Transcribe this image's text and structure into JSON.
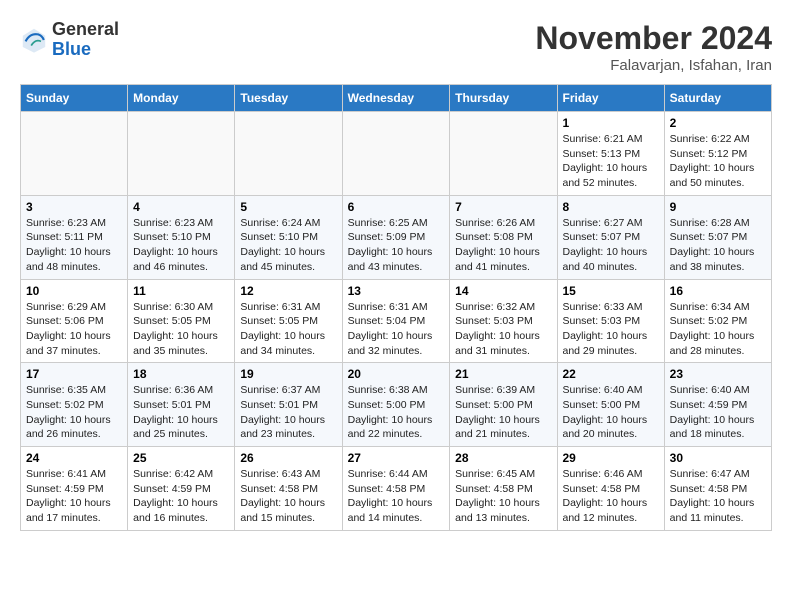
{
  "header": {
    "logo_line1": "General",
    "logo_line2": "Blue",
    "month": "November 2024",
    "location": "Falavarjan, Isfahan, Iran"
  },
  "weekdays": [
    "Sunday",
    "Monday",
    "Tuesday",
    "Wednesday",
    "Thursday",
    "Friday",
    "Saturday"
  ],
  "weeks": [
    [
      {
        "day": "",
        "info": ""
      },
      {
        "day": "",
        "info": ""
      },
      {
        "day": "",
        "info": ""
      },
      {
        "day": "",
        "info": ""
      },
      {
        "day": "",
        "info": ""
      },
      {
        "day": "1",
        "info": "Sunrise: 6:21 AM\nSunset: 5:13 PM\nDaylight: 10 hours\nand 52 minutes."
      },
      {
        "day": "2",
        "info": "Sunrise: 6:22 AM\nSunset: 5:12 PM\nDaylight: 10 hours\nand 50 minutes."
      }
    ],
    [
      {
        "day": "3",
        "info": "Sunrise: 6:23 AM\nSunset: 5:11 PM\nDaylight: 10 hours\nand 48 minutes."
      },
      {
        "day": "4",
        "info": "Sunrise: 6:23 AM\nSunset: 5:10 PM\nDaylight: 10 hours\nand 46 minutes."
      },
      {
        "day": "5",
        "info": "Sunrise: 6:24 AM\nSunset: 5:10 PM\nDaylight: 10 hours\nand 45 minutes."
      },
      {
        "day": "6",
        "info": "Sunrise: 6:25 AM\nSunset: 5:09 PM\nDaylight: 10 hours\nand 43 minutes."
      },
      {
        "day": "7",
        "info": "Sunrise: 6:26 AM\nSunset: 5:08 PM\nDaylight: 10 hours\nand 41 minutes."
      },
      {
        "day": "8",
        "info": "Sunrise: 6:27 AM\nSunset: 5:07 PM\nDaylight: 10 hours\nand 40 minutes."
      },
      {
        "day": "9",
        "info": "Sunrise: 6:28 AM\nSunset: 5:07 PM\nDaylight: 10 hours\nand 38 minutes."
      }
    ],
    [
      {
        "day": "10",
        "info": "Sunrise: 6:29 AM\nSunset: 5:06 PM\nDaylight: 10 hours\nand 37 minutes."
      },
      {
        "day": "11",
        "info": "Sunrise: 6:30 AM\nSunset: 5:05 PM\nDaylight: 10 hours\nand 35 minutes."
      },
      {
        "day": "12",
        "info": "Sunrise: 6:31 AM\nSunset: 5:05 PM\nDaylight: 10 hours\nand 34 minutes."
      },
      {
        "day": "13",
        "info": "Sunrise: 6:31 AM\nSunset: 5:04 PM\nDaylight: 10 hours\nand 32 minutes."
      },
      {
        "day": "14",
        "info": "Sunrise: 6:32 AM\nSunset: 5:03 PM\nDaylight: 10 hours\nand 31 minutes."
      },
      {
        "day": "15",
        "info": "Sunrise: 6:33 AM\nSunset: 5:03 PM\nDaylight: 10 hours\nand 29 minutes."
      },
      {
        "day": "16",
        "info": "Sunrise: 6:34 AM\nSunset: 5:02 PM\nDaylight: 10 hours\nand 28 minutes."
      }
    ],
    [
      {
        "day": "17",
        "info": "Sunrise: 6:35 AM\nSunset: 5:02 PM\nDaylight: 10 hours\nand 26 minutes."
      },
      {
        "day": "18",
        "info": "Sunrise: 6:36 AM\nSunset: 5:01 PM\nDaylight: 10 hours\nand 25 minutes."
      },
      {
        "day": "19",
        "info": "Sunrise: 6:37 AM\nSunset: 5:01 PM\nDaylight: 10 hours\nand 23 minutes."
      },
      {
        "day": "20",
        "info": "Sunrise: 6:38 AM\nSunset: 5:00 PM\nDaylight: 10 hours\nand 22 minutes."
      },
      {
        "day": "21",
        "info": "Sunrise: 6:39 AM\nSunset: 5:00 PM\nDaylight: 10 hours\nand 21 minutes."
      },
      {
        "day": "22",
        "info": "Sunrise: 6:40 AM\nSunset: 5:00 PM\nDaylight: 10 hours\nand 20 minutes."
      },
      {
        "day": "23",
        "info": "Sunrise: 6:40 AM\nSunset: 4:59 PM\nDaylight: 10 hours\nand 18 minutes."
      }
    ],
    [
      {
        "day": "24",
        "info": "Sunrise: 6:41 AM\nSunset: 4:59 PM\nDaylight: 10 hours\nand 17 minutes."
      },
      {
        "day": "25",
        "info": "Sunrise: 6:42 AM\nSunset: 4:59 PM\nDaylight: 10 hours\nand 16 minutes."
      },
      {
        "day": "26",
        "info": "Sunrise: 6:43 AM\nSunset: 4:58 PM\nDaylight: 10 hours\nand 15 minutes."
      },
      {
        "day": "27",
        "info": "Sunrise: 6:44 AM\nSunset: 4:58 PM\nDaylight: 10 hours\nand 14 minutes."
      },
      {
        "day": "28",
        "info": "Sunrise: 6:45 AM\nSunset: 4:58 PM\nDaylight: 10 hours\nand 13 minutes."
      },
      {
        "day": "29",
        "info": "Sunrise: 6:46 AM\nSunset: 4:58 PM\nDaylight: 10 hours\nand 12 minutes."
      },
      {
        "day": "30",
        "info": "Sunrise: 6:47 AM\nSunset: 4:58 PM\nDaylight: 10 hours\nand 11 minutes."
      }
    ]
  ]
}
